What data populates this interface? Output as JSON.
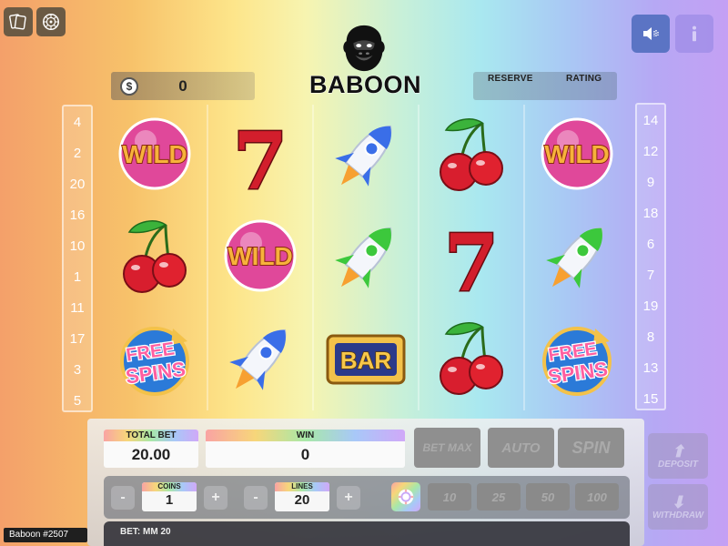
{
  "brand": {
    "logo_text": "BABOON"
  },
  "balance": {
    "currency_icon": "dollar-coin-icon",
    "value": "0"
  },
  "stats": {
    "reserve_label": "RESERVE",
    "rating_label": "RATING"
  },
  "top_left": {
    "cards_icon": "cards-icon",
    "roulette_icon": "roulette-icon"
  },
  "top_right": {
    "sound_icon": "speaker-icon",
    "info_icon": "info-icon"
  },
  "lines_left": [
    "4",
    "2",
    "20",
    "16",
    "10",
    "1",
    "11",
    "17",
    "3",
    "5"
  ],
  "lines_right": [
    "14",
    "12",
    "9",
    "18",
    "6",
    "7",
    "19",
    "8",
    "13",
    "15"
  ],
  "reels": [
    [
      "wild",
      "cherry",
      "free-spins"
    ],
    [
      "seven",
      "wild",
      "rocket-blue"
    ],
    [
      "rocket-blue",
      "rocket-green",
      "bar"
    ],
    [
      "cherry",
      "seven",
      "cherry"
    ],
    [
      "wild",
      "rocket-green",
      "free-spins"
    ]
  ],
  "symbol_text": {
    "wild": "WILD",
    "bar": "BAR",
    "free": "FREE",
    "spins": "SPINS",
    "seven": "7"
  },
  "controls": {
    "total_bet_label": "TOTAL BET",
    "total_bet_value": "20.00",
    "win_label": "WIN",
    "win_value": "0",
    "bet_max_label": "BET MAX",
    "auto_label": "AUTO",
    "spin_label": "SPIN",
    "coins_label": "COINS",
    "coins_value": "1",
    "lines_label": "LINES",
    "lines_value": "20",
    "minus": "-",
    "plus": "+",
    "chips": [
      "10",
      "25",
      "50",
      "100"
    ],
    "deposit_label": "DEPOSIT",
    "withdraw_label": "WITHDRAW",
    "bet_line": "BET: MM 20"
  },
  "footer": {
    "game_id": "Baboon #2507"
  },
  "colors": {
    "panel_gray": "#8f8f8f",
    "sound_btn": "#5b74c4",
    "info_btn": "#a08ee8"
  }
}
